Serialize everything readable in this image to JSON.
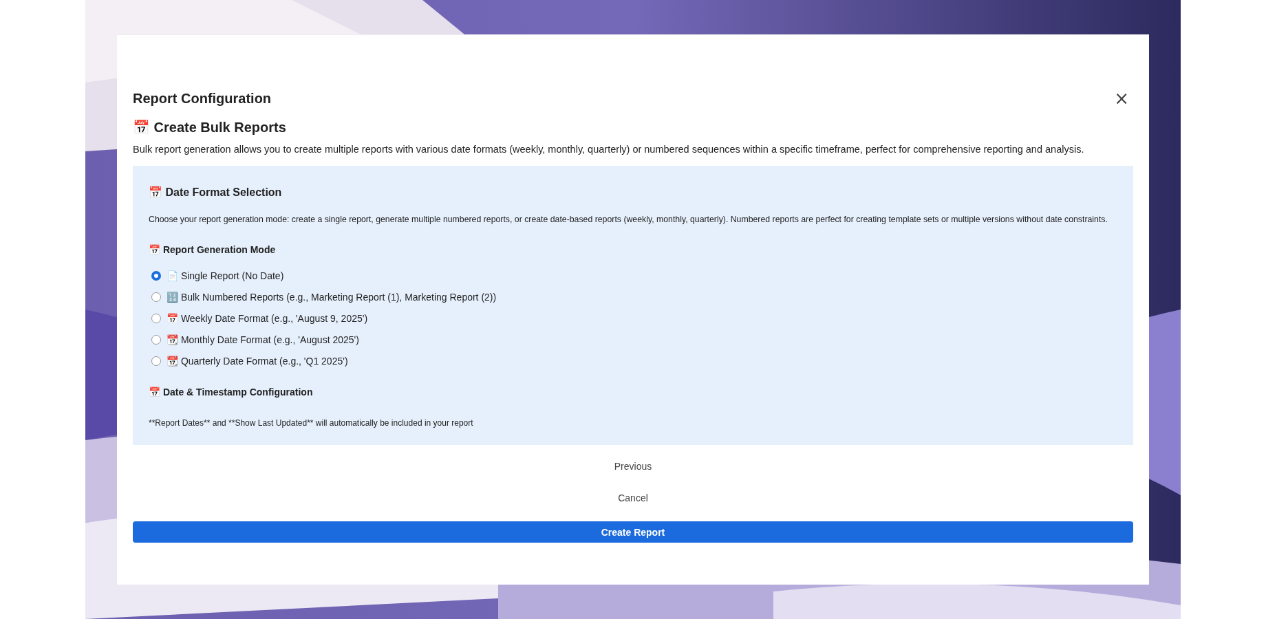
{
  "dialog": {
    "title": "Report Configuration",
    "close_label": "×",
    "heading": "📅 Create Bulk Reports",
    "description": "Bulk report generation allows you to create multiple reports with various date formats (weekly, monthly, quarterly) or numbered sequences within a specific timeframe, perfect for comprehensive reporting and analysis.",
    "panel": {
      "title": "📅 Date Format Selection",
      "intro": "Choose your report generation mode: create a single report, generate multiple numbered reports, or create date-based reports (weekly, monthly, quarterly). Numbered reports are perfect for creating template sets or multiple versions without date constraints.",
      "mode_label": "📅 Report Generation Mode",
      "modes": [
        {
          "label": "📄 Single Report (No Date)",
          "selected": true
        },
        {
          "label": "🔢 Bulk Numbered Reports (e.g., Marketing Report (1), Marketing Report (2))",
          "selected": false
        },
        {
          "label": "📅 Weekly Date Format (e.g., 'August 9, 2025')",
          "selected": false
        },
        {
          "label": "📆 Monthly Date Format (e.g., 'August 2025')",
          "selected": false
        },
        {
          "label": "📆 Quarterly Date Format (e.g., 'Q1 2025')",
          "selected": false
        }
      ],
      "timestamp_label": "📅 Date & Timestamp Configuration",
      "timestamp_note": "**Report Dates** and **Show Last Updated** will automatically be included in your report"
    },
    "buttons": [
      {
        "label": "Previous",
        "kind": "link"
      },
      {
        "label": "Cancel",
        "kind": "link"
      },
      {
        "label": "Create Report",
        "kind": "primary"
      }
    ]
  }
}
